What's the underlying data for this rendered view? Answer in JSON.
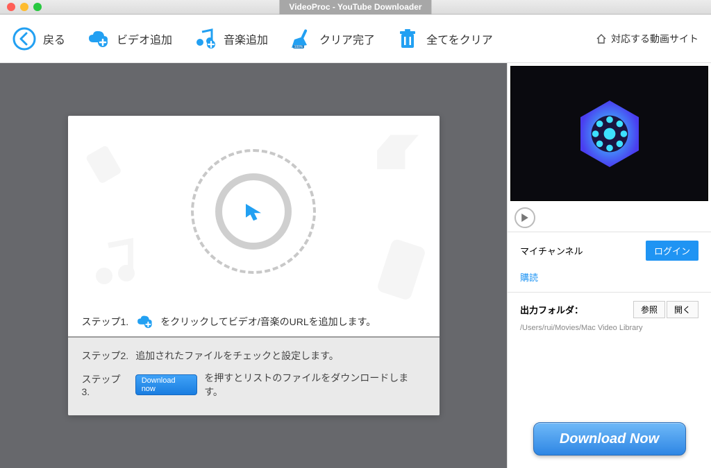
{
  "window": {
    "title": "VideoProc - YouTube Downloader"
  },
  "toolbar": {
    "back": "戻る",
    "add_video": "ビデオ追加",
    "add_music": "音楽追加",
    "clear_done": "クリア完了",
    "clear_all": "全てをクリア",
    "sites": "対応する動画サイト"
  },
  "steps": {
    "s1_label": "ステップ1.",
    "s1_text": "をクリックしてビデオ/音楽のURLを追加します。",
    "s2_label": "ステップ2.",
    "s2_text": "追加されたファイルをチェックと設定します。",
    "s3_label": "ステップ3.",
    "s3_pill": "Download now",
    "s3_text": "を押すとリストのファイルをダウンロードします。"
  },
  "right": {
    "channel_label": "マイチャンネル",
    "login": "ログイン",
    "subscribe": "購読",
    "output_label": "出力フォルダ：",
    "browse": "参照",
    "open": "開く",
    "output_path": "/Users/rui/Movies/Mac Video Library",
    "download_now": "Download Now"
  }
}
